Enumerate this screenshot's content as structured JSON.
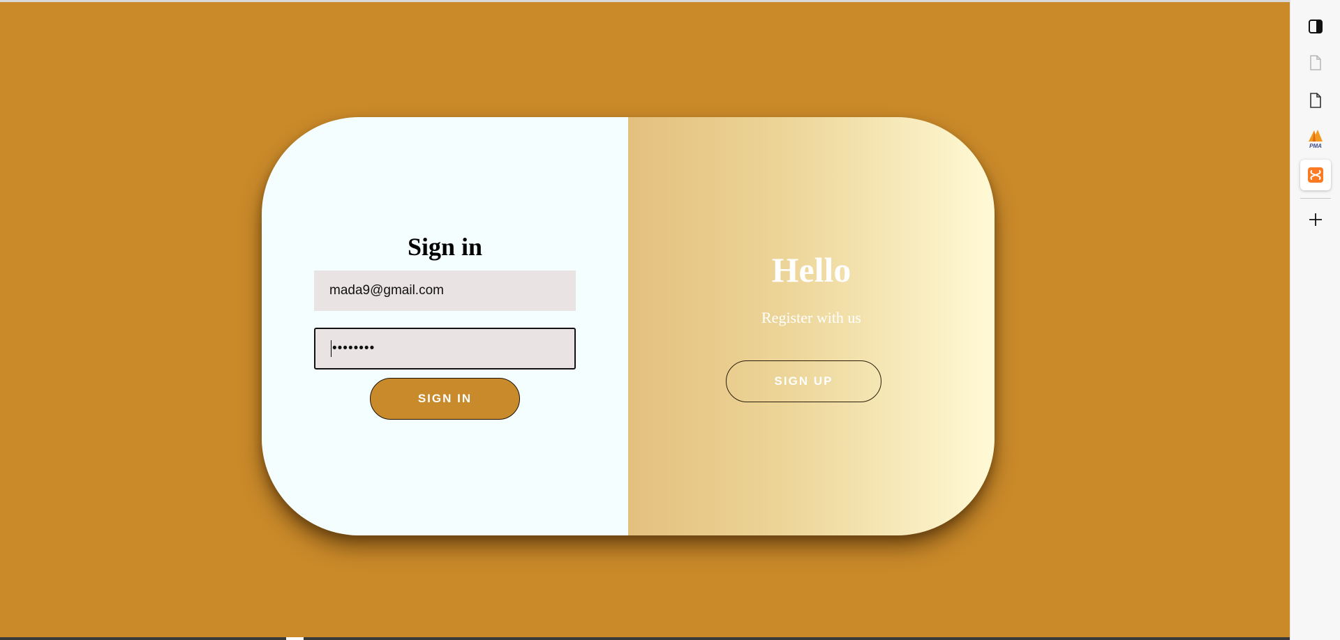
{
  "signin": {
    "title": "Sign in",
    "email_value": "mada9@gmail.com",
    "password_value": "••••••••",
    "button_label": "SIGN IN"
  },
  "panel": {
    "title": "Hello",
    "subtitle": "Register with us",
    "button_label": "SIGN UP"
  },
  "sidebar": {
    "items": [
      {
        "icon": "panel-toggle-icon"
      },
      {
        "icon": "document-icon-faded"
      },
      {
        "icon": "document-icon"
      },
      {
        "icon": "phpmyadmin-icon",
        "logo_text": "PMA"
      },
      {
        "icon": "xampp-icon",
        "active": true
      },
      {
        "icon": "add-icon"
      }
    ]
  },
  "colors": {
    "background": "#ca8a2a",
    "card_left": "#f4feff",
    "gradient_start": "#e4c07e",
    "gradient_end": "#fffad6",
    "input_bg": "#e9e3e3",
    "accent_button": "#c98a2b"
  }
}
